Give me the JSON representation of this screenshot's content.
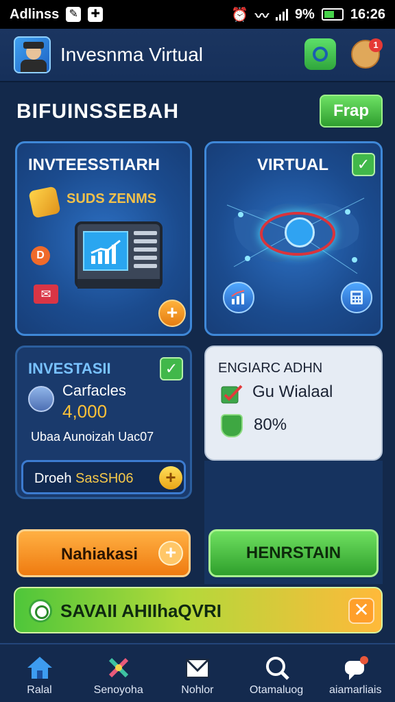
{
  "status_bar": {
    "carrier": "Adlinss",
    "battery_percent": "9%",
    "time": "16:26"
  },
  "header": {
    "title": "Invesnma Virtual",
    "notification_count": "1"
  },
  "section": {
    "title": "BIFUINSSEBAH",
    "action_label": "Frap"
  },
  "card_investasi": {
    "title": "INVTEESSTIARH",
    "subtitle": "SUDS ZENMS"
  },
  "card_virtual": {
    "title": "VIRTUAL"
  },
  "card_investasi_detail": {
    "title": "INVESTASII",
    "label": "Carfacles",
    "amount": "4,000",
    "description": "Ubaa Aunoizah Uac07",
    "input_prefix": "Droeh ",
    "input_value": "SasSH06"
  },
  "card_english": {
    "title": "ENGIARC ADHN",
    "line1": "Gu Wialaal",
    "line2": "80%"
  },
  "buttons": {
    "orange_label": "Nahiakasi",
    "green_label": "HENRSTAIN"
  },
  "banner": {
    "text": "SAVAII AHIIhaQVRI"
  },
  "bottom_nav": [
    {
      "label": "Ralal",
      "icon": "home-icon"
    },
    {
      "label": "Senoyoha",
      "icon": "tools-icon"
    },
    {
      "label": "Nohlor",
      "icon": "mail-icon"
    },
    {
      "label": "Otamaluog",
      "icon": "search-icon"
    },
    {
      "label": "aiamarliais",
      "icon": "chat-icon"
    }
  ],
  "colors": {
    "background": "#13294b",
    "accent_green": "#41b84a",
    "accent_orange": "#ef7b10",
    "accent_blue": "#3f88d8"
  }
}
